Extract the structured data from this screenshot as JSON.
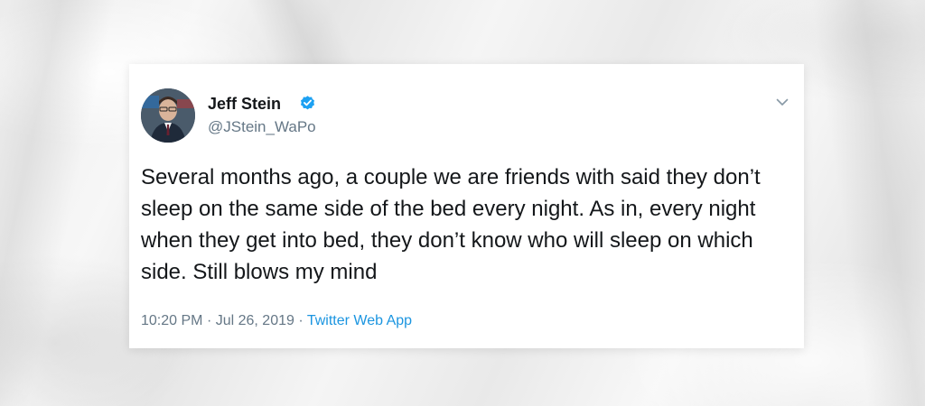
{
  "tweet": {
    "author_name": "Jeff Stein",
    "handle": "@JStein_WaPo",
    "verified": true,
    "text": "Several months ago, a couple we are friends with said they don’t sleep on the same side of the bed every night. As in, every night when they get into bed, they don’t know who will sleep on which side. Still blows my mind",
    "time": "10:20 PM",
    "date": "Jul 26, 2019",
    "separator": "·",
    "source": "Twitter Web App",
    "icons": {
      "verified": "verified-badge-icon",
      "menu": "chevron-down-icon"
    },
    "colors": {
      "accent": "#1b95e0",
      "verified": "#1da1f2",
      "text": "#14171a",
      "muted": "#657786"
    }
  }
}
